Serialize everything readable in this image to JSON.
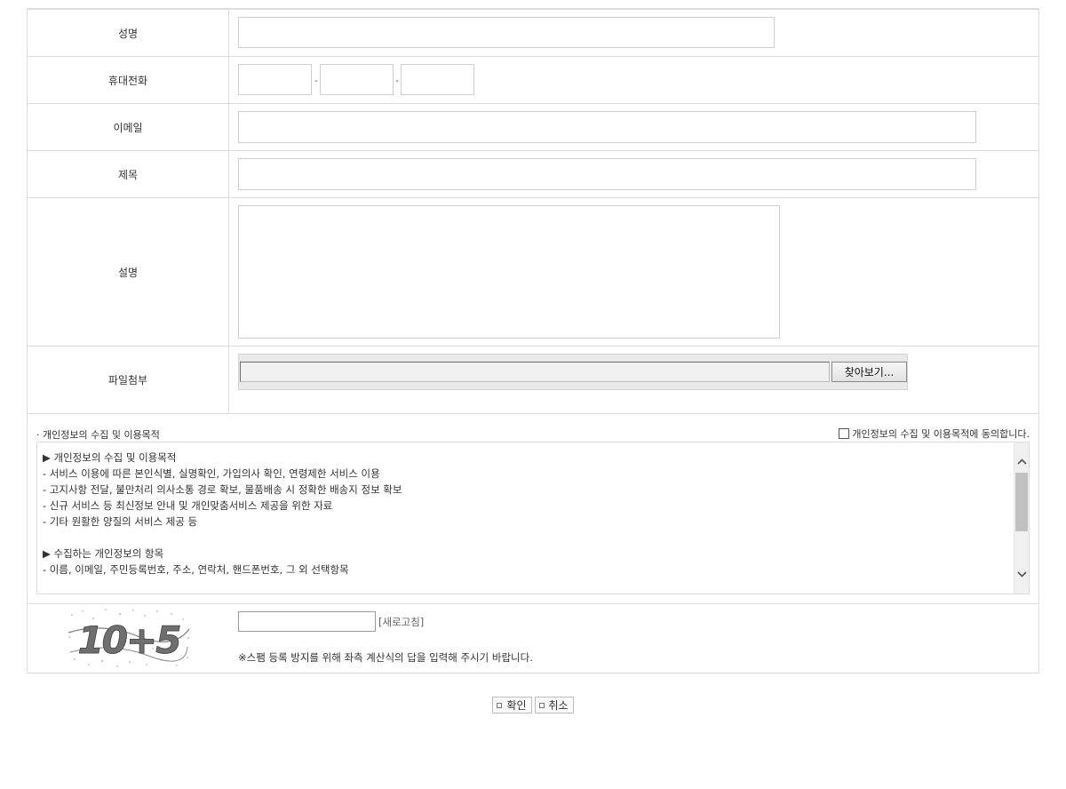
{
  "form": {
    "name_label": "성명",
    "phone_label": "휴대전화",
    "phone_sep": "-",
    "email_label": "이메일",
    "subject_label": "제목",
    "description_label": "설명",
    "file_label": "파일첨부",
    "file_button": "찾아보기..."
  },
  "privacy": {
    "title": "· 개인정보의 수집 및 이용목적",
    "agree_label": "개인정보의 수집 및 이용목적에 동의합니다.",
    "agree_checked": false,
    "lines": [
      "▶ 개인정보의 수집 및 이용목적",
      "- 서비스 이용에 따른 본인식별, 실명확인, 가입의사 확인, 연령제한 서비스 이용",
      "- 고지사항 전달, 불만처리 의사소통 경로 확보, 물품배송 시 정확한 배송지 정보 확보",
      "- 신규 서비스 등 최신정보 안내 및 개인맞춤서비스 제공을 위한 자료",
      "- 기타 원활한 양질의 서비스 제공 등",
      "",
      "▶ 수집하는 개인정보의 항목",
      "- 이름, 이메일, 주민등록번호, 주소, 연락처, 핸드폰번호, 그 외 선택항목"
    ]
  },
  "captcha": {
    "refresh_label": "[새로고침]",
    "note": "※스팸 등록 방지를 위해 좌측 계산식의 답을 입력해 주시기 바랍니다.",
    "image_text": "10+5"
  },
  "buttons": {
    "confirm": "확인",
    "cancel": "취소"
  },
  "icons": {
    "scroll_up": "chevron-up-icon",
    "scroll_down": "chevron-down-icon"
  }
}
